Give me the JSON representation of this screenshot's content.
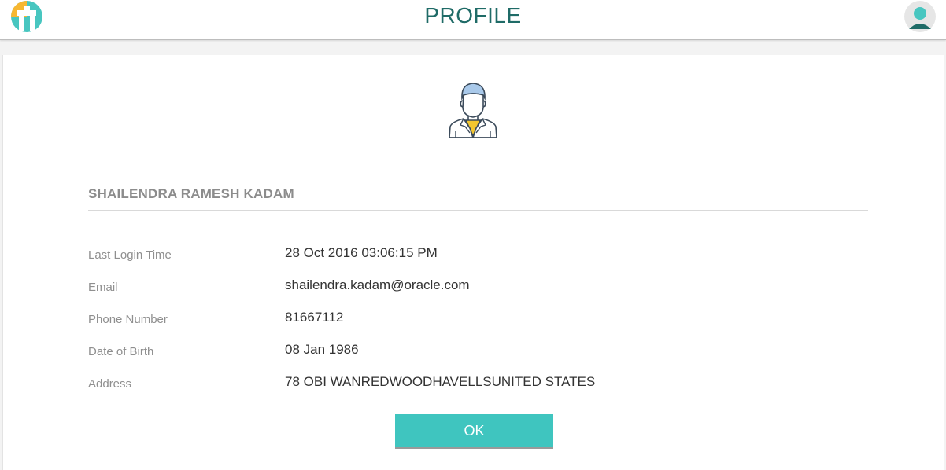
{
  "header": {
    "title": "PROFILE",
    "logo_icon": "app-logo-icon",
    "avatar_icon": "user-avatar-icon"
  },
  "profile": {
    "picture_icon": "person-avatar-icon",
    "name": "SHAILENDRA RAMESH KADAM",
    "details": [
      {
        "label": "Last Login Time",
        "value": "28 Oct 2016 03:06:15 PM"
      },
      {
        "label": "Email",
        "value": "shailendra.kadam@oracle.com"
      },
      {
        "label": "Phone Number",
        "value": "81667112"
      },
      {
        "label": "Date of Birth",
        "value": "08 Jan 1986"
      },
      {
        "label": "Address",
        "value": "78 OBI WANREDWOODHAVELLSUNITED STATES"
      }
    ]
  },
  "actions": {
    "ok_label": "OK"
  },
  "colors": {
    "accent": "#3fc5bf",
    "title": "#1f6b67",
    "logo_yellow": "#f7b731",
    "logo_teal": "#48c6c0"
  }
}
